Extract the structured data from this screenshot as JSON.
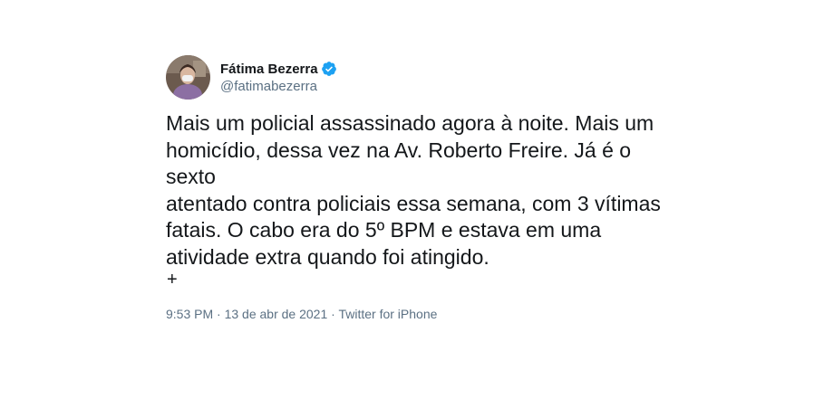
{
  "tweet": {
    "author": {
      "display_name": "Fátima Bezerra",
      "handle": "@fatimabezerra",
      "verified_icon": "verified-badge-icon",
      "avatar_icon": "profile-photo"
    },
    "text": "Mais um policial assassinado agora à noite. Mais um\nhomicídio, dessa vez na Av. Roberto Freire. Já é o sexto\natentado contra policiais essa semana, com 3 vítimas\nfatais. O cabo era do 5º BPM e estava em uma\natividade extra quando foi atingido.",
    "expand_symbol": "+",
    "meta": {
      "time": "9:53 PM",
      "separator": " · ",
      "date": "13 de abr de 2021",
      "source": "Twitter for iPhone"
    }
  },
  "colors": {
    "text": "#14171a",
    "secondary": "#5b7083",
    "verified": "#1da1f2"
  }
}
